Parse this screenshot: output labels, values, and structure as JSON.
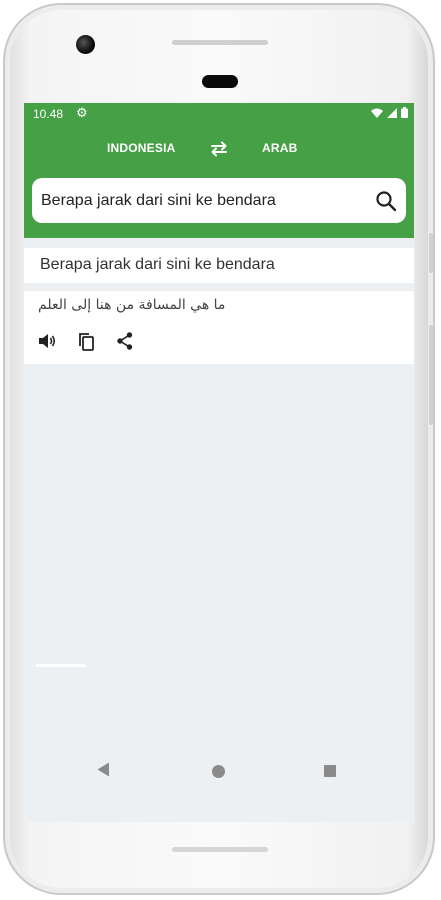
{
  "status_bar": {
    "time": "10.48",
    "icons": [
      "gear-icon",
      "wifi-icon",
      "signal-icon",
      "battery-icon"
    ]
  },
  "language_bar": {
    "source_language": "INDONESIA",
    "target_language": "ARAB",
    "swap_icon": "swap-arrows-icon"
  },
  "search": {
    "value": "Berapa jarak dari sini ke bendara",
    "icon": "search-icon"
  },
  "result": {
    "source_text": "Berapa jarak dari sini ke bendara",
    "translated_text": "ما هي المسافة من هنا إلى العلم",
    "actions": [
      "speaker-icon",
      "copy-icon",
      "share-icon"
    ]
  },
  "nav_bar": {
    "icons": [
      "back-icon",
      "home-icon",
      "recents-icon"
    ]
  },
  "colors": {
    "app_bar": "#46a046",
    "screen_background": "#edf0f2",
    "card_background": "#ffffff"
  }
}
